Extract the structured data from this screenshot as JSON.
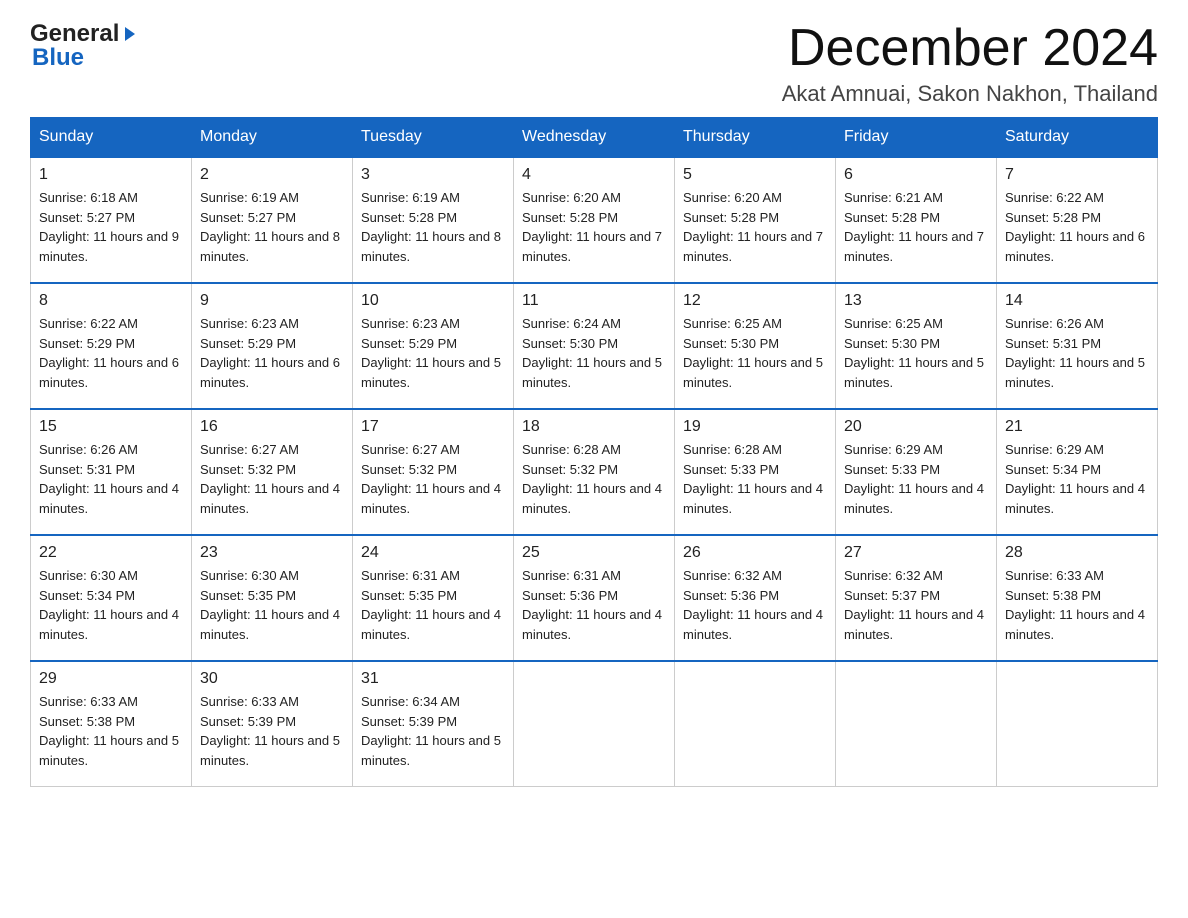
{
  "logo": {
    "line1": "General",
    "line2": "Blue"
  },
  "title": "December 2024",
  "subtitle": "Akat Amnuai, Sakon Nakhon, Thailand",
  "days": [
    "Sunday",
    "Monday",
    "Tuesday",
    "Wednesday",
    "Thursday",
    "Friday",
    "Saturday"
  ],
  "weeks": [
    [
      {
        "date": "1",
        "sunrise": "6:18 AM",
        "sunset": "5:27 PM",
        "daylight": "11 hours and 9 minutes."
      },
      {
        "date": "2",
        "sunrise": "6:19 AM",
        "sunset": "5:27 PM",
        "daylight": "11 hours and 8 minutes."
      },
      {
        "date": "3",
        "sunrise": "6:19 AM",
        "sunset": "5:28 PM",
        "daylight": "11 hours and 8 minutes."
      },
      {
        "date": "4",
        "sunrise": "6:20 AM",
        "sunset": "5:28 PM",
        "daylight": "11 hours and 7 minutes."
      },
      {
        "date": "5",
        "sunrise": "6:20 AM",
        "sunset": "5:28 PM",
        "daylight": "11 hours and 7 minutes."
      },
      {
        "date": "6",
        "sunrise": "6:21 AM",
        "sunset": "5:28 PM",
        "daylight": "11 hours and 7 minutes."
      },
      {
        "date": "7",
        "sunrise": "6:22 AM",
        "sunset": "5:28 PM",
        "daylight": "11 hours and 6 minutes."
      }
    ],
    [
      {
        "date": "8",
        "sunrise": "6:22 AM",
        "sunset": "5:29 PM",
        "daylight": "11 hours and 6 minutes."
      },
      {
        "date": "9",
        "sunrise": "6:23 AM",
        "sunset": "5:29 PM",
        "daylight": "11 hours and 6 minutes."
      },
      {
        "date": "10",
        "sunrise": "6:23 AM",
        "sunset": "5:29 PM",
        "daylight": "11 hours and 5 minutes."
      },
      {
        "date": "11",
        "sunrise": "6:24 AM",
        "sunset": "5:30 PM",
        "daylight": "11 hours and 5 minutes."
      },
      {
        "date": "12",
        "sunrise": "6:25 AM",
        "sunset": "5:30 PM",
        "daylight": "11 hours and 5 minutes."
      },
      {
        "date": "13",
        "sunrise": "6:25 AM",
        "sunset": "5:30 PM",
        "daylight": "11 hours and 5 minutes."
      },
      {
        "date": "14",
        "sunrise": "6:26 AM",
        "sunset": "5:31 PM",
        "daylight": "11 hours and 5 minutes."
      }
    ],
    [
      {
        "date": "15",
        "sunrise": "6:26 AM",
        "sunset": "5:31 PM",
        "daylight": "11 hours and 4 minutes."
      },
      {
        "date": "16",
        "sunrise": "6:27 AM",
        "sunset": "5:32 PM",
        "daylight": "11 hours and 4 minutes."
      },
      {
        "date": "17",
        "sunrise": "6:27 AM",
        "sunset": "5:32 PM",
        "daylight": "11 hours and 4 minutes."
      },
      {
        "date": "18",
        "sunrise": "6:28 AM",
        "sunset": "5:32 PM",
        "daylight": "11 hours and 4 minutes."
      },
      {
        "date": "19",
        "sunrise": "6:28 AM",
        "sunset": "5:33 PM",
        "daylight": "11 hours and 4 minutes."
      },
      {
        "date": "20",
        "sunrise": "6:29 AM",
        "sunset": "5:33 PM",
        "daylight": "11 hours and 4 minutes."
      },
      {
        "date": "21",
        "sunrise": "6:29 AM",
        "sunset": "5:34 PM",
        "daylight": "11 hours and 4 minutes."
      }
    ],
    [
      {
        "date": "22",
        "sunrise": "6:30 AM",
        "sunset": "5:34 PM",
        "daylight": "11 hours and 4 minutes."
      },
      {
        "date": "23",
        "sunrise": "6:30 AM",
        "sunset": "5:35 PM",
        "daylight": "11 hours and 4 minutes."
      },
      {
        "date": "24",
        "sunrise": "6:31 AM",
        "sunset": "5:35 PM",
        "daylight": "11 hours and 4 minutes."
      },
      {
        "date": "25",
        "sunrise": "6:31 AM",
        "sunset": "5:36 PM",
        "daylight": "11 hours and 4 minutes."
      },
      {
        "date": "26",
        "sunrise": "6:32 AM",
        "sunset": "5:36 PM",
        "daylight": "11 hours and 4 minutes."
      },
      {
        "date": "27",
        "sunrise": "6:32 AM",
        "sunset": "5:37 PM",
        "daylight": "11 hours and 4 minutes."
      },
      {
        "date": "28",
        "sunrise": "6:33 AM",
        "sunset": "5:38 PM",
        "daylight": "11 hours and 4 minutes."
      }
    ],
    [
      {
        "date": "29",
        "sunrise": "6:33 AM",
        "sunset": "5:38 PM",
        "daylight": "11 hours and 5 minutes."
      },
      {
        "date": "30",
        "sunrise": "6:33 AM",
        "sunset": "5:39 PM",
        "daylight": "11 hours and 5 minutes."
      },
      {
        "date": "31",
        "sunrise": "6:34 AM",
        "sunset": "5:39 PM",
        "daylight": "11 hours and 5 minutes."
      },
      null,
      null,
      null,
      null
    ]
  ]
}
